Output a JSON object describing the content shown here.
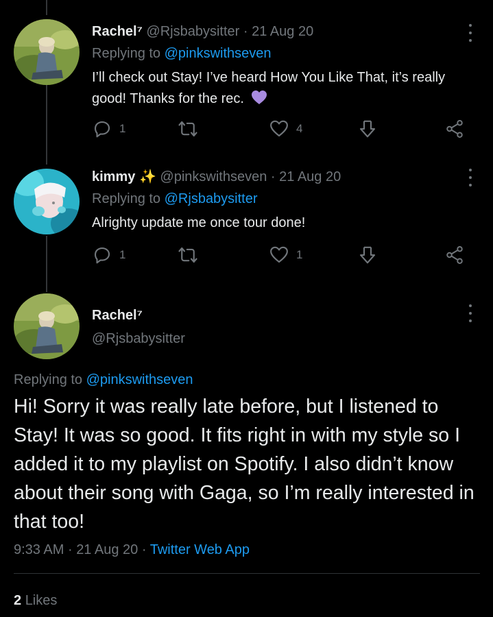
{
  "tweets": [
    {
      "name": "Rachel⁷",
      "handle": "@Rjsbabysitter",
      "sep": "·",
      "date": "21 Aug 20",
      "replying_prefix": "Replying to",
      "replying_to": "@pinkswithseven",
      "text": "I’ll check out Stay! I’ve heard How You Like That, it’s really good! Thanks for the rec.",
      "emoji": "purple-heart",
      "replies": "1",
      "retweets": "",
      "likes": "4"
    },
    {
      "name": "kimmy",
      "name_emoji": "✨",
      "handle": "@pinkswithseven",
      "sep": "·",
      "date": "21 Aug 20",
      "replying_prefix": "Replying to",
      "replying_to": "@Rjsbabysitter",
      "text": "Alrighty update me once tour done!",
      "replies": "1",
      "retweets": "",
      "likes": "1"
    }
  ],
  "main": {
    "name": "Rachel⁷",
    "handle": "@Rjsbabysitter",
    "replying_prefix": "Replying to",
    "replying_to": "@pinkswithseven",
    "text": "Hi! Sorry it was really late before, but I listened to Stay! It was so good. It fits right in with my style so I added it to my playlist on Spotify. I also didn’t know about their song with Gaga, so I’m really interested in that too!",
    "time": "9:33 AM",
    "sep1": "·",
    "date": "21 Aug 20",
    "sep2": "·",
    "source": "Twitter Web App",
    "likes_count": "2",
    "likes_label": "Likes"
  },
  "colors": {
    "background": "#000000",
    "text": "#e7e9ea",
    "muted": "#71767b",
    "link": "#1d9bf0",
    "heart_emoji": "#a88be0"
  },
  "icons": [
    "more-icon",
    "reply-icon",
    "retweet-icon",
    "like-icon",
    "bookmark-icon",
    "share-icon"
  ]
}
